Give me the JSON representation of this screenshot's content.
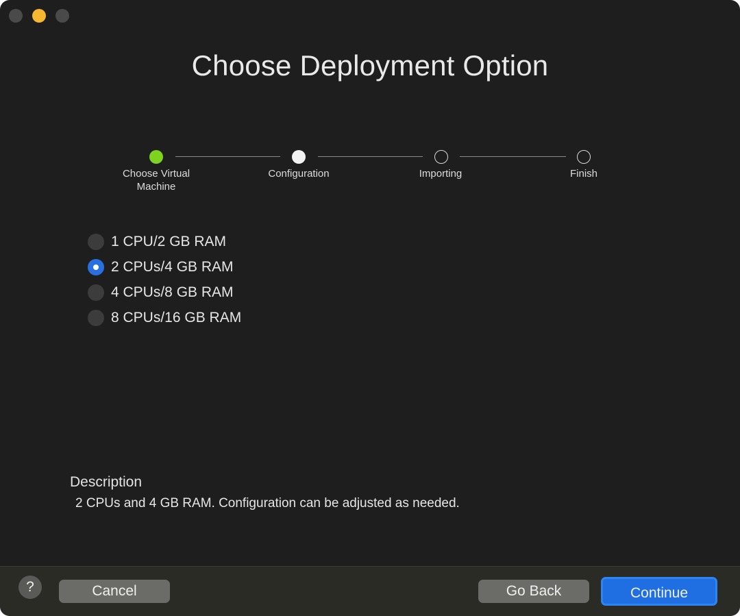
{
  "window": {
    "title": "Choose Deployment Option"
  },
  "steps": [
    {
      "label": "Choose Virtual Machine",
      "state": "done"
    },
    {
      "label": "Configuration",
      "state": "current"
    },
    {
      "label": "Importing",
      "state": "todo"
    },
    {
      "label": "Finish",
      "state": "todo"
    }
  ],
  "options": [
    {
      "label": "1 CPU/2 GB RAM",
      "selected": false
    },
    {
      "label": "2 CPUs/4 GB RAM",
      "selected": true
    },
    {
      "label": "4 CPUs/8 GB RAM",
      "selected": false
    },
    {
      "label": "8 CPUs/16 GB RAM",
      "selected": false
    }
  ],
  "description": {
    "title": "Description",
    "text": "2 CPUs and 4 GB RAM. Configuration can be adjusted as needed."
  },
  "footer": {
    "help_label": "?",
    "cancel_label": "Cancel",
    "back_label": "Go Back",
    "continue_label": "Continue"
  },
  "colors": {
    "accent": "#2a6fe0",
    "step_done": "#7ed321",
    "window_bg": "#1e1e1e",
    "minimize": "#f5b830"
  }
}
